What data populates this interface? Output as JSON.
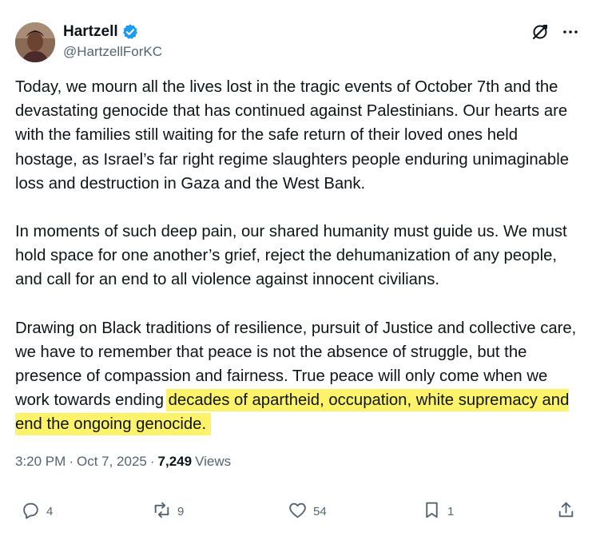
{
  "author": {
    "name": "Hartzell",
    "handle": "@HartzellForKC",
    "verified": true
  },
  "post": {
    "paragraphs": [
      "Today, we mourn all the lives lost in the tragic events of October 7th and the devastating genocide that has continued against Palestinians. Our hearts are with the families still waiting for the safe return of their loved ones held hostage, as Israel’s far right regime slaughters people enduring unimaginable loss and destruction in Gaza and the West Bank.",
      "In moments of such deep pain, our shared humanity must guide us. We must hold space for one another’s grief, reject the dehumanization of any people, and call for an end to all violence against innocent civilians."
    ],
    "paragraph3_plain": "Drawing on Black traditions of resilience, pursuit of Justice and collective care, we have to remember that peace is not the absence of struggle, but the presence of compassion and fairness. True peace will only come when we work towards ending ",
    "paragraph3_highlight": "decades of apartheid, occupation, white supremacy and end the ongoing genocide."
  },
  "meta": {
    "time": "3:20 PM",
    "separator": "·",
    "date": "Oct 7, 2025",
    "views_count": "7,249",
    "views_label": "Views"
  },
  "actions": {
    "replies": "4",
    "reposts": "9",
    "likes": "54",
    "bookmarks": "1"
  },
  "colors": {
    "text": "#0f1419",
    "secondary": "#536471",
    "verified": "#1d9bf0",
    "highlight": "#fdf36b"
  },
  "icons": [
    "verified-badge-icon",
    "grok-icon",
    "more-icon",
    "reply-icon",
    "repost-icon",
    "like-icon",
    "bookmark-icon",
    "share-icon"
  ]
}
